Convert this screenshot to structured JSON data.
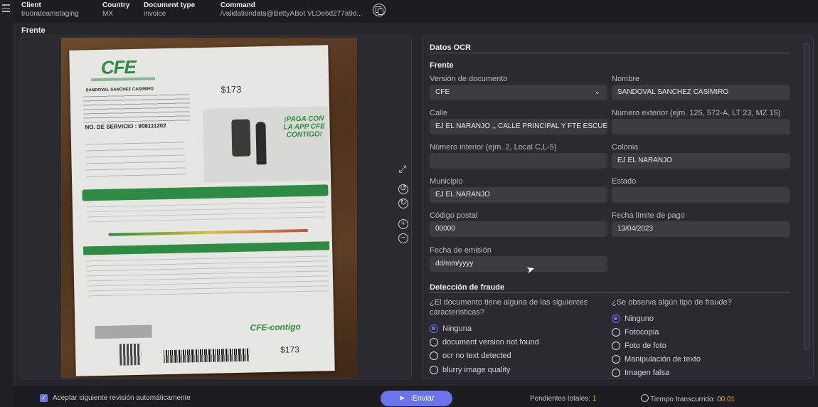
{
  "header": {
    "client": {
      "label": "Client",
      "value": "truorateamstaging"
    },
    "country": {
      "label": "Country",
      "value": "MX"
    },
    "document_type": {
      "label": "Document type",
      "value": "invoice"
    },
    "command": {
      "label": "Command",
      "value": "/validationdata@BettyABot VLDe6d277a9d..."
    }
  },
  "section_title": "Frente",
  "document_image": {
    "logo": "CFE",
    "customer": "SANDOVAL SANCHEZ CASIMIRO",
    "service_line": "NO. DE SERVICIO : 908111202",
    "total": "$173",
    "promo": "¡PAGA CON LA APP CFE CONTIGO!",
    "footer_logo": "CFE-contigo",
    "footer_total": "$173"
  },
  "ocr": {
    "title": "Datos OCR",
    "subtitle": "Frente",
    "fields": {
      "doc_version": {
        "label": "Versión de documento",
        "value": "CFE"
      },
      "nombre": {
        "label": "Nombre",
        "value": "SANDOVAL SANCHEZ CASIMIRO"
      },
      "calle": {
        "label": "Calle",
        "value": "EJ EL NARANJO ,, CALLE PRINCIPAL Y FTE ESCUELA PR"
      },
      "num_ext": {
        "label": "Número exterior (ejm. 125, 572-A, LT 23, MZ 15)",
        "value": ""
      },
      "num_int": {
        "label": "Número interior (ejm. 2, Local C,L-5)",
        "value": ""
      },
      "colonia": {
        "label": "Colonia",
        "value": "EJ EL NARANJO"
      },
      "municipio": {
        "label": "Municipio",
        "value": "EJ EL NARANJO"
      },
      "estado": {
        "label": "Estado",
        "value": ""
      },
      "cp": {
        "label": "Código postal",
        "value": "00000"
      },
      "fecha_limite": {
        "label": "Fecha límite de pago",
        "value": "13/04/2023"
      },
      "fecha_emision": {
        "label": "Fecha de emisión",
        "value": "dd/mm/yyyy"
      }
    },
    "fraud": {
      "title": "Detección de fraude",
      "q1": "¿El documento tiene alguna de las siguientes características?",
      "q1_options": [
        "Ninguna",
        "document version not found",
        "ocr no text detected",
        "blurry image quality"
      ],
      "q1_selected": "Ninguna",
      "q2": "¿Se observa algún tipo de fraude?",
      "q2_options": [
        "Ninguno",
        "Fotocopia",
        "Foto de foto",
        "Manipulación de texto",
        "Imagen falsa"
      ],
      "q2_selected": "Ninguno"
    }
  },
  "footer": {
    "auto_next_label": "Aceptar siguiente revisión automáticamente",
    "auto_next_checked": true,
    "send_label": "Enviar",
    "pending_label": "Pendientes totales:",
    "pending_value": "1",
    "time_label": "Tiempo transcurrido:",
    "time_value": "00:01"
  },
  "colors": {
    "accent": "#6b74e8",
    "highlight": "#e6b020",
    "cfe_green": "#2f8b43"
  }
}
